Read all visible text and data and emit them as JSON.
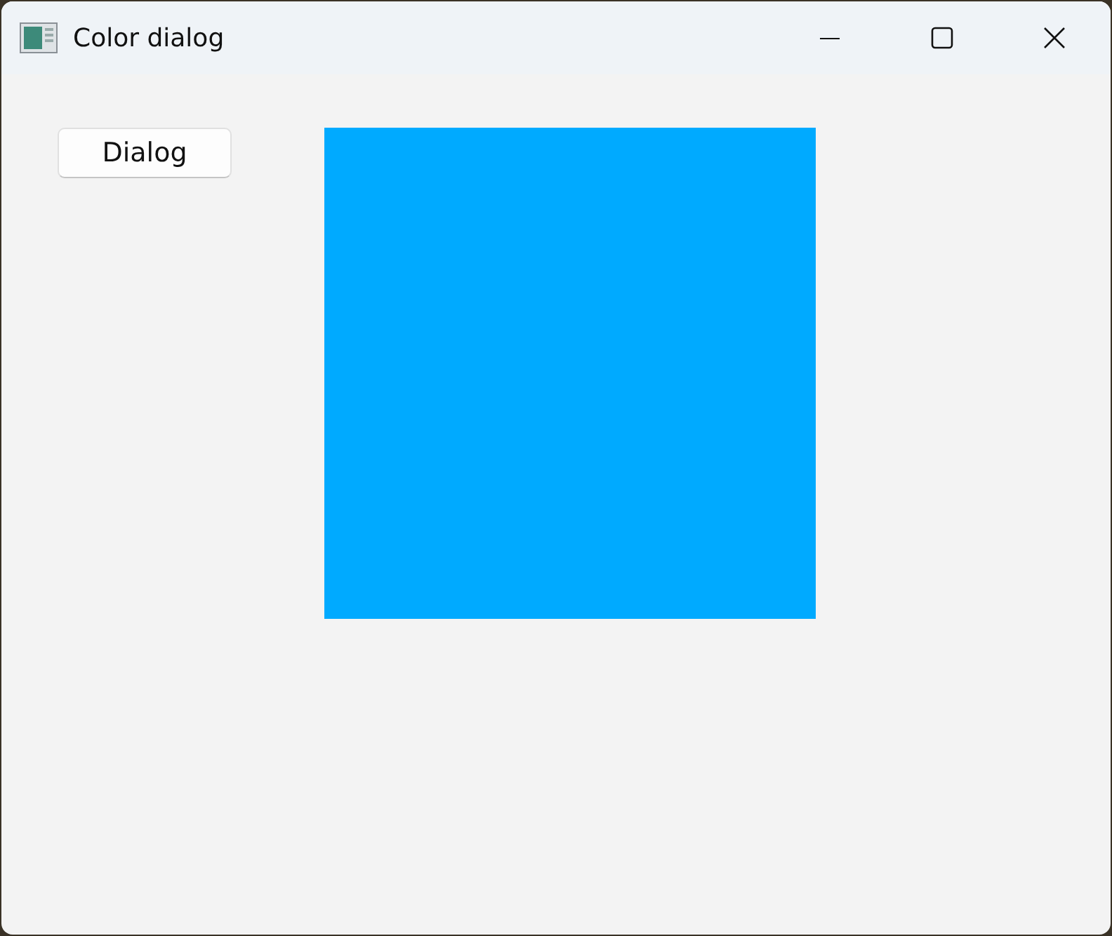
{
  "window": {
    "title": "Color dialog"
  },
  "button": {
    "label": "Dialog"
  },
  "swatch": {
    "color": "#00aaff"
  }
}
